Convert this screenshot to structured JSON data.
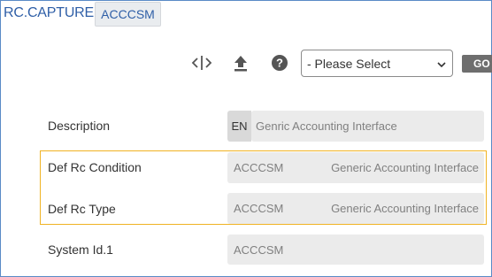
{
  "header": {
    "app_title": "RC.CAPTURE",
    "tab_label": "ACCCSM"
  },
  "toolbar": {
    "icons": [
      "code-icon",
      "upload-icon",
      "help-icon"
    ],
    "select_value": "- Please Select",
    "go_label": "GO"
  },
  "form": {
    "description": {
      "label": "Description",
      "lang": "EN",
      "value": "Genric Accounting Interface"
    },
    "def_rc_condition": {
      "label": "Def Rc Condition",
      "code": "ACCCSM",
      "desc": "Generic Accounting Interface"
    },
    "def_rc_type": {
      "label": "Def Rc Type",
      "code": "ACCCSM",
      "desc": "Generic Accounting Interface"
    },
    "system_id1": {
      "label": "System Id.1",
      "code": "ACCCSM"
    }
  },
  "colors": {
    "title_blue": "#2f5fa7",
    "highlight_border": "#f0b323",
    "field_bg": "#ebebeb",
    "go_bg": "#6e6e6e"
  }
}
